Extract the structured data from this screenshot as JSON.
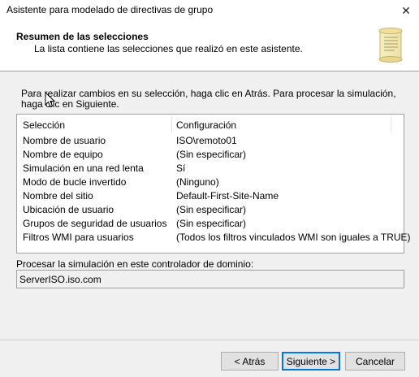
{
  "window": {
    "title": "Asistente para modelado de directivas de grupo",
    "close_glyph": "✕"
  },
  "header": {
    "title": "Resumen de las selecciones",
    "subtitle": "La lista contiene las selecciones que realizó en este asistente.",
    "icon": "scroll-icon"
  },
  "instruction": "Para realizar cambios en su selección, haga clic en Atrás. Para procesar la simulación, haga clic en Siguiente.",
  "summary": {
    "columns": [
      "Selección",
      "Configuración"
    ],
    "rows": [
      {
        "selection": "Nombre de usuario",
        "config": "ISO\\remoto01"
      },
      {
        "selection": "Nombre de equipo",
        "config": "(Sin especificar)"
      },
      {
        "selection": "Simulación en una red lenta",
        "config": "Sí"
      },
      {
        "selection": "Modo de bucle invertido",
        "config": "(Ninguno)"
      },
      {
        "selection": "Nombre del sitio",
        "config": "Default-First-Site-Name"
      },
      {
        "selection": "Ubicación de usuario",
        "config": "(Sin especificar)"
      },
      {
        "selection": "Grupos de seguridad de usuarios",
        "config": "(Sin especificar)"
      },
      {
        "selection": "Filtros WMI para usuarios",
        "config": "(Todos los filtros vinculados WMI son iguales a TRUE)"
      }
    ]
  },
  "domain_controller": {
    "label": "Procesar la simulación en este controlador de dominio:",
    "value": "ServerISO.iso.com"
  },
  "buttons": {
    "back": "< Atrás",
    "next": "Siguiente >",
    "cancel": "Cancelar"
  },
  "colors": {
    "default_button_border": "#0078d7",
    "window_bg": "#f0f0f0"
  }
}
